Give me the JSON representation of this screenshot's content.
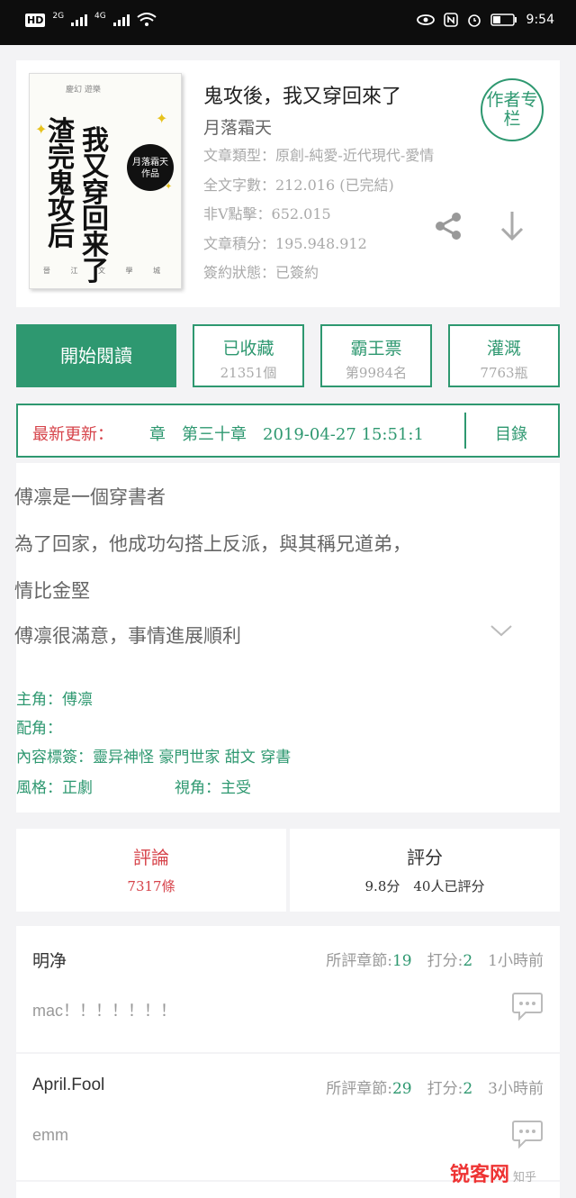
{
  "status_bar": {
    "network1": "2G",
    "network2": "4G",
    "hd": "HD",
    "time": "9:54"
  },
  "book": {
    "cover": {
      "top_text": "慶幻 遊樂",
      "title": "渣完鬼攻后",
      "subtitle": "我又穿回来了",
      "author_badge": [
        "月落霜天",
        "作品"
      ],
      "bottom_text": "晉 江 文 學 城"
    },
    "title": "鬼攻後，我又穿回來了",
    "author": "月落霜天",
    "author_badge": "作者专栏",
    "meta": [
      "文章類型：原創-純愛-近代現代-愛情",
      "全文字數：212.016 (已完結)",
      "非V點擊：652.015",
      "文章積分：195.948.912",
      "簽約狀態：已簽約"
    ]
  },
  "actions": {
    "start_reading": "開始閱讀",
    "stats": [
      {
        "label": "已收藏",
        "value": "21351個"
      },
      {
        "label": "霸王票",
        "value": "第9984名"
      },
      {
        "label": "灌溉",
        "value": "7763瓶"
      }
    ]
  },
  "latest": {
    "label": "最新更新：",
    "chapter": "章　第三十章　2019-04-27 15:51:1",
    "catalog": "目錄"
  },
  "description": {
    "lines": [
      "傅凛是一個穿書者",
      "為了回家，他成功勾搭上反派，與其稱兄道弟，",
      "情比金堅",
      "傅凛很滿意，事情進展順利"
    ]
  },
  "tags": {
    "protagonist": "主角：傅凛",
    "supporting": "配角：",
    "content_tags": "內容標簽：靈异神怪 豪門世家 甜文 穿書",
    "style": "風格：正劇",
    "perspective": "視角：主受"
  },
  "rating": {
    "comments": {
      "label": "評論",
      "count": "7317條"
    },
    "score": {
      "label": "評分",
      "detail": "9.8分　40人已評分"
    }
  },
  "comments": [
    {
      "user": "明净",
      "chapter_label": "所評章節:",
      "chapter": "19",
      "score_label": "打分:",
      "score": "2",
      "time": "1小時前",
      "text": "mac！！！！！！！"
    },
    {
      "user": "April.Fool",
      "chapter_label": "所評章節:",
      "chapter": "29",
      "score_label": "打分:",
      "score": "2",
      "time": "3小時前",
      "text": "emm"
    }
  ],
  "watermark": {
    "brand": "锐客网",
    "sub": "知乎"
  },
  "colors": {
    "accent": "#2e9870",
    "red": "#d6434a"
  }
}
